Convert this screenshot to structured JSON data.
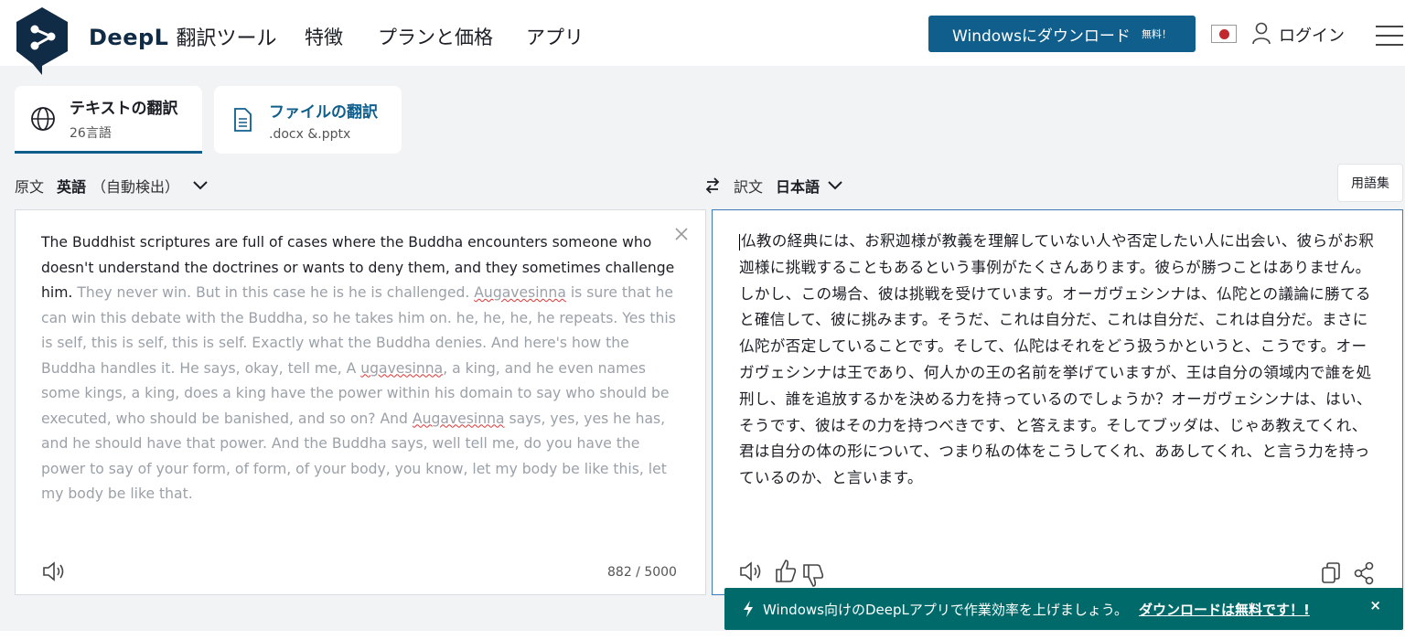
{
  "header": {
    "brand_name": "DeepL",
    "brand_sub": "翻訳ツール",
    "nav": [
      "特徴",
      "プランと価格",
      "アプリ"
    ],
    "download_label": "Windowsにダウンロード",
    "download_free": "無料！",
    "login": "ログイン"
  },
  "tabs": [
    {
      "name": "テキストの翻訳",
      "sub": "26言語",
      "icon": "globe-icon"
    },
    {
      "name": "ファイルの翻訳",
      "sub": ".docx &.pptx",
      "icon": "document-icon"
    }
  ],
  "source": {
    "label": "原文",
    "language": "英語",
    "detect": "（自動検出）",
    "text_dark": "The Buddhist scriptures are full of cases where the Buddha encounters someone who doesn't understand the doctrines or wants to deny them, and they sometimes challenge him.",
    "text_1": " They never win. But in this case he is he is challenged. ",
    "mis_1": "Augavesinna",
    "text_2": " is sure that he can win this debate with the Buddha, so he takes him on. he, he, he, he repeats. Yes this is self, this is self, this is self. Exactly what the Buddha denies. And here's how the Buddha handles it. He says, okay, tell me, A ",
    "mis_2": "ugavesinna",
    "text_3": ", a king, and he even names some kings, a king, does a king have the power within his domain to say who should be executed, who should be banished, and so on? And ",
    "mis_3": "Augavesinna",
    "text_4": " says, yes, yes he has, and he should have that power. And the Buddha says, well tell me, do you have the power to say of your form, of form, of your body, you know, let my body be like this, let my body be like that.",
    "counter": "882 / 5000"
  },
  "target": {
    "label": "訳文",
    "language": "日本語",
    "glossary": "用語集",
    "text": "仏教の経典には、お釈迦様が教義を理解していない人や否定したい人に出会い、彼らがお釈迦様に挑戦することもあるという事例がたくさんあります。彼らが勝つことはありません。しかし、この場合、彼は挑戦を受けています。オーガヴェシンナは、仏陀との議論に勝てると確信して、彼に挑みます。そうだ、これは自分だ、これは自分だ、これは自分だ。まさに仏陀が否定していることです。そして、仏陀はそれをどう扱うかというと、こうです。オーガヴェシンナは王であり、何人かの王の名前を挙げていますが、王は自分の領域内で誰を処刑し、誰を追放するかを決める力を持っているのでしょうか？オーガヴェシンナは、はい、そうです、彼はその力を持つべきです、と答えます。そしてブッダは、じゃあ教えてくれ、君は自分の体の形について、つまり私の体をこうしてくれ、ああしてくれ、と言う力を持っているのか、と言います。"
  },
  "banner": {
    "text": "Windows向けのDeepLアプリで作業効率を上げましょう。",
    "link": "ダウンロードは無料です！!",
    "close": "×"
  },
  "colors": {
    "brand": "#0f2b46",
    "accent": "#0f5e8c",
    "banner": "#006a6a"
  }
}
